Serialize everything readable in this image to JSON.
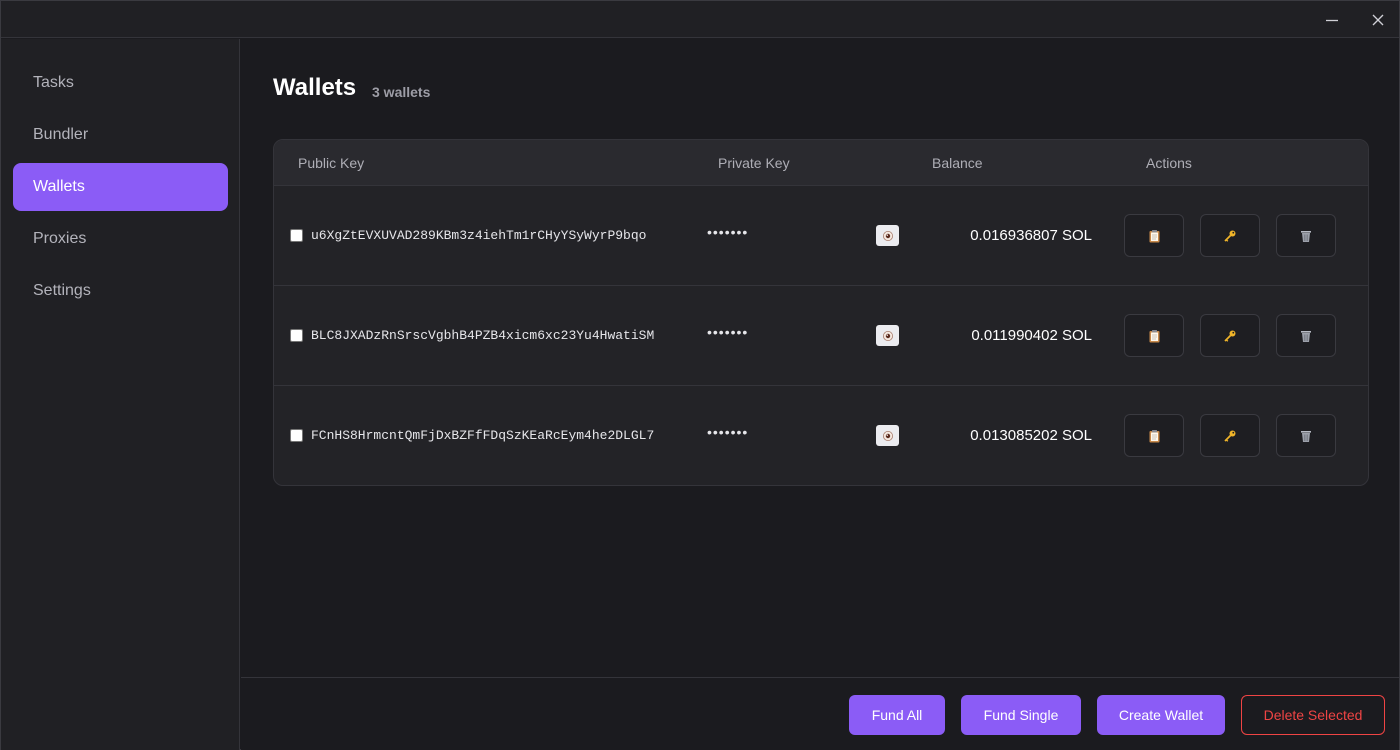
{
  "window": {
    "minimize_icon": "minimize-icon",
    "close_icon": "close-icon"
  },
  "sidebar": {
    "items": [
      {
        "label": "Tasks",
        "active": false
      },
      {
        "label": "Bundler",
        "active": false
      },
      {
        "label": "Wallets",
        "active": true
      },
      {
        "label": "Proxies",
        "active": false
      },
      {
        "label": "Settings",
        "active": false
      }
    ]
  },
  "main": {
    "title": "Wallets",
    "count": "3 wallets"
  },
  "table": {
    "headers": {
      "public_key": "Public Key",
      "private_key": "Private Key",
      "balance": "Balance",
      "actions": "Actions"
    },
    "rows": [
      {
        "public_key": "u6XgZtEVXUVAD289KBm3z4iehTm1rCHyYSyWyrP9bqo",
        "private_key": "•••••••",
        "balance": "0.016936807 SOL",
        "checked": false
      },
      {
        "public_key": "BLC8JXADzRnSrscVgbhB4PZB4xicm6xc23Yu4HwatiSM",
        "private_key": "•••••••",
        "balance": "0.011990402 SOL",
        "checked": false
      },
      {
        "public_key": "FCnHS8HrmcntQmFjDxBZFfFDqSzKEaRcEym4he2DLGL7",
        "private_key": "•••••••",
        "balance": "0.013085202 SOL",
        "checked": false
      }
    ],
    "row_icons": {
      "reveal": "eye-icon",
      "copy": "clipboard-icon",
      "key": "key-icon",
      "delete": "trash-icon"
    }
  },
  "footer": {
    "fund_all": "Fund All",
    "fund_single": "Fund Single",
    "create_wallet": "Create Wallet",
    "delete_selected": "Delete Selected"
  },
  "colors": {
    "accent": "#8b5cf6",
    "danger": "#ef4444",
    "background": "#1b1b1f",
    "sidebar": "#202024"
  }
}
